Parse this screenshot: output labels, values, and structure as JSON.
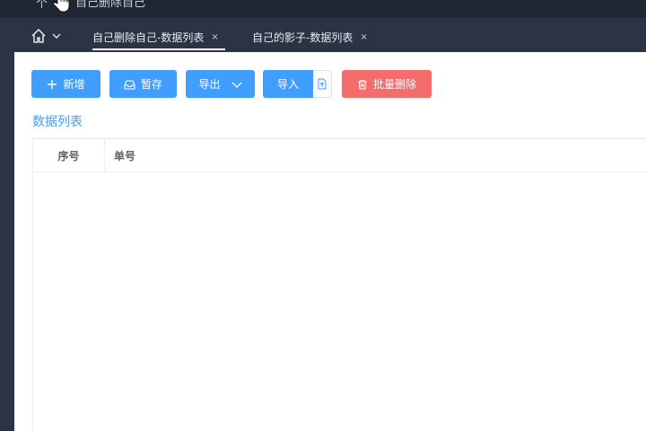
{
  "header": {
    "partial_title": "自己删除自己",
    "left_glyph": "个"
  },
  "tabs": [
    {
      "label": "自己删除自己-数据列表",
      "close": "×",
      "active": true
    },
    {
      "label": "自己的影子-数据列表",
      "close": "×",
      "active": false
    }
  ],
  "toolbar": {
    "add_label": "新增",
    "save_label": "暂存",
    "export_label": "导出",
    "import_label": "导入",
    "delete_label": "批量删除"
  },
  "section": {
    "title": "数据列表"
  },
  "table": {
    "columns": [
      "序号",
      "单号"
    ],
    "rows": []
  },
  "colors": {
    "primary": "#409eff",
    "danger": "#f56c6c",
    "nav_bg": "#2b3444",
    "topbar_bg": "#1f2735"
  },
  "icons": {
    "home": "home-icon",
    "chevron": "chevron-down-icon",
    "add": "plus-icon",
    "save": "inbox-icon",
    "upload": "file-upload-icon",
    "delete": "trash-icon"
  }
}
